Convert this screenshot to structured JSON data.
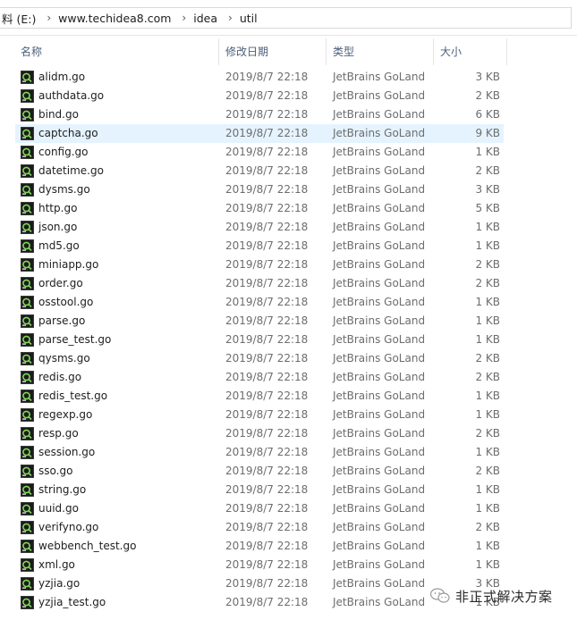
{
  "breadcrumb": [
    "料 (E:)",
    "www.techidea8.com",
    "idea",
    "util"
  ],
  "columns": {
    "name": "名称",
    "date": "修改日期",
    "type": "类型",
    "size": "大小"
  },
  "files": [
    {
      "name": "alidm.go",
      "date": "2019/8/7 22:18",
      "type": "JetBrains GoLand",
      "size": "3 KB"
    },
    {
      "name": "authdata.go",
      "date": "2019/8/7 22:18",
      "type": "JetBrains GoLand",
      "size": "2 KB"
    },
    {
      "name": "bind.go",
      "date": "2019/8/7 22:18",
      "type": "JetBrains GoLand",
      "size": "6 KB"
    },
    {
      "name": "captcha.go",
      "date": "2019/8/7 22:18",
      "type": "JetBrains GoLand",
      "size": "9 KB",
      "selected": true
    },
    {
      "name": "config.go",
      "date": "2019/8/7 22:18",
      "type": "JetBrains GoLand",
      "size": "1 KB"
    },
    {
      "name": "datetime.go",
      "date": "2019/8/7 22:18",
      "type": "JetBrains GoLand",
      "size": "2 KB"
    },
    {
      "name": "dysms.go",
      "date": "2019/8/7 22:18",
      "type": "JetBrains GoLand",
      "size": "3 KB"
    },
    {
      "name": "http.go",
      "date": "2019/8/7 22:18",
      "type": "JetBrains GoLand",
      "size": "5 KB"
    },
    {
      "name": "json.go",
      "date": "2019/8/7 22:18",
      "type": "JetBrains GoLand",
      "size": "1 KB"
    },
    {
      "name": "md5.go",
      "date": "2019/8/7 22:18",
      "type": "JetBrains GoLand",
      "size": "1 KB"
    },
    {
      "name": "miniapp.go",
      "date": "2019/8/7 22:18",
      "type": "JetBrains GoLand",
      "size": "2 KB"
    },
    {
      "name": "order.go",
      "date": "2019/8/7 22:18",
      "type": "JetBrains GoLand",
      "size": "2 KB"
    },
    {
      "name": "osstool.go",
      "date": "2019/8/7 22:18",
      "type": "JetBrains GoLand",
      "size": "1 KB"
    },
    {
      "name": "parse.go",
      "date": "2019/8/7 22:18",
      "type": "JetBrains GoLand",
      "size": "1 KB"
    },
    {
      "name": "parse_test.go",
      "date": "2019/8/7 22:18",
      "type": "JetBrains GoLand",
      "size": "1 KB"
    },
    {
      "name": "qysms.go",
      "date": "2019/8/7 22:18",
      "type": "JetBrains GoLand",
      "size": "2 KB"
    },
    {
      "name": "redis.go",
      "date": "2019/8/7 22:18",
      "type": "JetBrains GoLand",
      "size": "2 KB"
    },
    {
      "name": "redis_test.go",
      "date": "2019/8/7 22:18",
      "type": "JetBrains GoLand",
      "size": "1 KB"
    },
    {
      "name": "regexp.go",
      "date": "2019/8/7 22:18",
      "type": "JetBrains GoLand",
      "size": "1 KB"
    },
    {
      "name": "resp.go",
      "date": "2019/8/7 22:18",
      "type": "JetBrains GoLand",
      "size": "2 KB"
    },
    {
      "name": "session.go",
      "date": "2019/8/7 22:18",
      "type": "JetBrains GoLand",
      "size": "1 KB"
    },
    {
      "name": "sso.go",
      "date": "2019/8/7 22:18",
      "type": "JetBrains GoLand",
      "size": "2 KB"
    },
    {
      "name": "string.go",
      "date": "2019/8/7 22:18",
      "type": "JetBrains GoLand",
      "size": "1 KB"
    },
    {
      "name": "uuid.go",
      "date": "2019/8/7 22:18",
      "type": "JetBrains GoLand",
      "size": "1 KB"
    },
    {
      "name": "verifyno.go",
      "date": "2019/8/7 22:18",
      "type": "JetBrains GoLand",
      "size": "2 KB"
    },
    {
      "name": "webbench_test.go",
      "date": "2019/8/7 22:18",
      "type": "JetBrains GoLand",
      "size": "1 KB"
    },
    {
      "name": "xml.go",
      "date": "2019/8/7 22:18",
      "type": "JetBrains GoLand",
      "size": "1 KB"
    },
    {
      "name": "yzjia.go",
      "date": "2019/8/7 22:18",
      "type": "JetBrains GoLand",
      "size": "3 KB"
    },
    {
      "name": "yzjia_test.go",
      "date": "2019/8/7 22:18",
      "type": "JetBrains GoLand",
      "size": "1 KB"
    }
  ],
  "watermark": {
    "text": "非正式解决方案",
    "icon": "wechat-icon"
  },
  "colors": {
    "selection": "#e5f3ff",
    "header_text": "#4c607a",
    "icon_green": "#7ed957"
  }
}
